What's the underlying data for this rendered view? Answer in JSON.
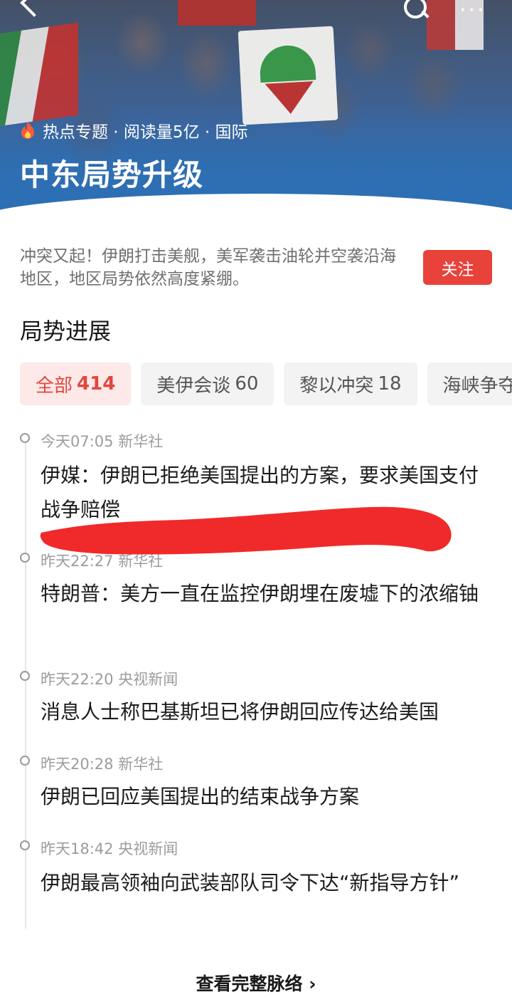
{
  "header": {
    "meta_label": "热点专题 · 阅读量5亿 · 国际",
    "title": "中东局势升级",
    "more_glyph": "···"
  },
  "summary": {
    "text": "冲突又起！伊朗打击美舰，美军袭击油轮并空袭沿海地区，地区局势依然高度紧绷。",
    "follow_label": "关注"
  },
  "section": {
    "title": "局势进展"
  },
  "tabs": [
    {
      "label": "全部",
      "count": "414"
    },
    {
      "label": "美伊会谈",
      "count": "60"
    },
    {
      "label": "黎以冲突",
      "count": "18"
    },
    {
      "label": "海峡争夺",
      "count": ""
    }
  ],
  "timeline": [
    {
      "time": "今天07:05 新华社",
      "headline": "伊媒：伊朗已拒绝美国提出的方案，要求美国支付战争赔偿"
    },
    {
      "time": "昨天22:27 新华社",
      "headline": "特朗普：美方一直在监控伊朗埋在废墟下的浓缩铀"
    },
    {
      "time": "昨天22:20 央视新闻",
      "headline": "消息人士称巴基斯坦已将伊朗回应传达给美国"
    },
    {
      "time": "昨天20:28 新华社",
      "headline": "伊朗已回应美国提出的结束战争方案"
    },
    {
      "time": "昨天18:42 央视新闻",
      "headline": "伊朗最高领袖向武装部队司令下达“新指导方针”"
    }
  ],
  "footer": {
    "more_label": "查看完整脉络 ›"
  },
  "colors": {
    "accent": "#e8423b",
    "banner": "#2f6fb3",
    "scribble": "#f02a2a"
  }
}
